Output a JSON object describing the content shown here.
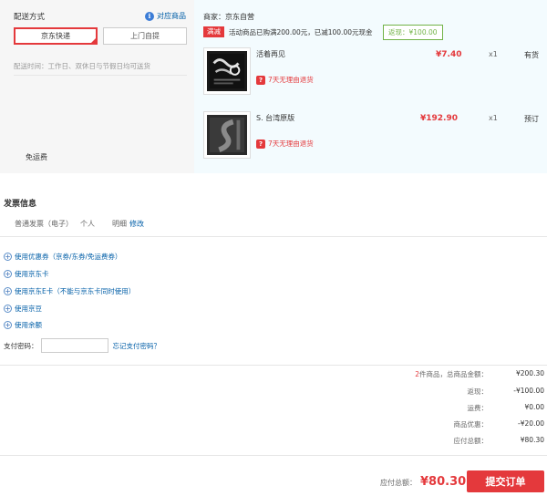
{
  "shipping": {
    "title": "配送方式",
    "match_link": "对应商品",
    "options": [
      "京东快递",
      "上门自提"
    ],
    "time": "配送时间：工作日、双休日与节假日均可送货",
    "fee": "免运费"
  },
  "goods": {
    "merchant": "商家：京东自营",
    "promo_tag": "满减",
    "promo_text": "活动商品已购满200.00元，已减100.00元现金",
    "rebate": "返现：¥100.00",
    "items": [
      {
        "name": "活着再见",
        "price": "¥7.40",
        "qty": "x1",
        "stock": "有货",
        "return": "7天无理由退货"
      },
      {
        "name": "S. 台湾原版",
        "price": "¥192.90",
        "qty": "x1",
        "stock": "预订",
        "return": "7天无理由退货"
      }
    ]
  },
  "invoice": {
    "title": "发票信息",
    "type": "普通发票（电子）",
    "holder": "个人",
    "detail": "明细",
    "edit": "修改"
  },
  "coupons": [
    "使用优惠券（京券/东券/免运费券）",
    "使用京东卡",
    "使用京东E卡（不能与京东卡同时使用）",
    "使用京豆",
    "使用余额"
  ],
  "payment": {
    "pwd_label": "支付密码：",
    "forgot": "忘记支付密码？"
  },
  "summary": {
    "count": "2",
    "count_suffix": "件商品，总商品金额：",
    "items": [
      {
        "label": "返现：",
        "value": "-¥100.00"
      },
      {
        "label": "运费：",
        "value": "¥0.00"
      },
      {
        "label": "商品优惠：",
        "value": "-¥20.00"
      },
      {
        "label": "应付总额：",
        "value": "¥80.30"
      }
    ],
    "goods_total": "¥200.30"
  },
  "footer": {
    "total_label": "应付总额：",
    "total": "¥80.30",
    "submit": "提交订单"
  }
}
